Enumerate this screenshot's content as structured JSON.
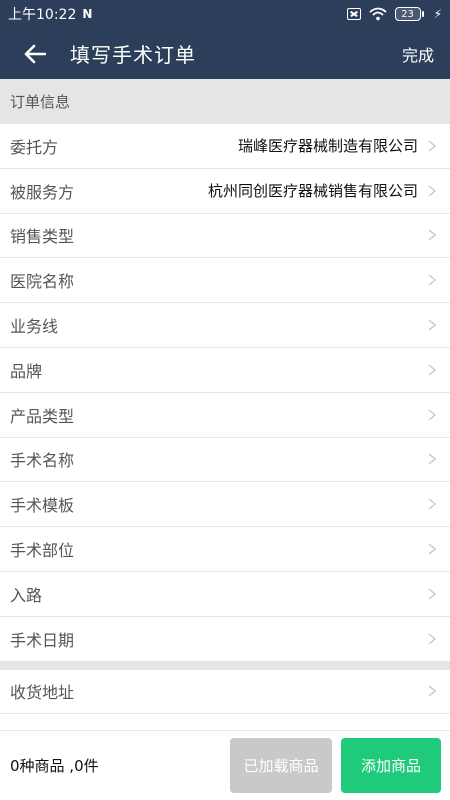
{
  "status_bar": {
    "time": "上午10:22",
    "battery_level": "23",
    "icons": [
      "n-notification-icon",
      "sim-none-icon",
      "wifi-icon",
      "battery-icon",
      "charging-icon"
    ]
  },
  "navbar": {
    "back_icon": "arrow-left-icon",
    "title": "填写手术订单",
    "done_label": "完成"
  },
  "section": {
    "title": "订单信息"
  },
  "fields": [
    {
      "label": "委托方",
      "value": "瑞峰医疗器械制造有限公司"
    },
    {
      "label": "被服务方",
      "value": "杭州同创医疗器械销售有限公司"
    },
    {
      "label": "销售类型",
      "value": ""
    },
    {
      "label": "医院名称",
      "value": ""
    },
    {
      "label": "业务线",
      "value": ""
    },
    {
      "label": "品牌",
      "value": ""
    },
    {
      "label": "产品类型",
      "value": ""
    },
    {
      "label": "手术名称",
      "value": ""
    },
    {
      "label": "手术模板",
      "value": ""
    },
    {
      "label": "手术部位",
      "value": ""
    },
    {
      "label": "入路",
      "value": ""
    },
    {
      "label": "手术日期",
      "value": ""
    }
  ],
  "shipping": {
    "label": "收货地址"
  },
  "bottom_bar": {
    "summary": "0种商品 ,0件",
    "loaded_button": "已加载商品",
    "add_button": "添加商品"
  },
  "colors": {
    "header_bg": "#2c3e5a",
    "section_bg": "#e5e5e5",
    "add_button": "#1fcb7a",
    "loaded_button": "#c9c9c9"
  }
}
